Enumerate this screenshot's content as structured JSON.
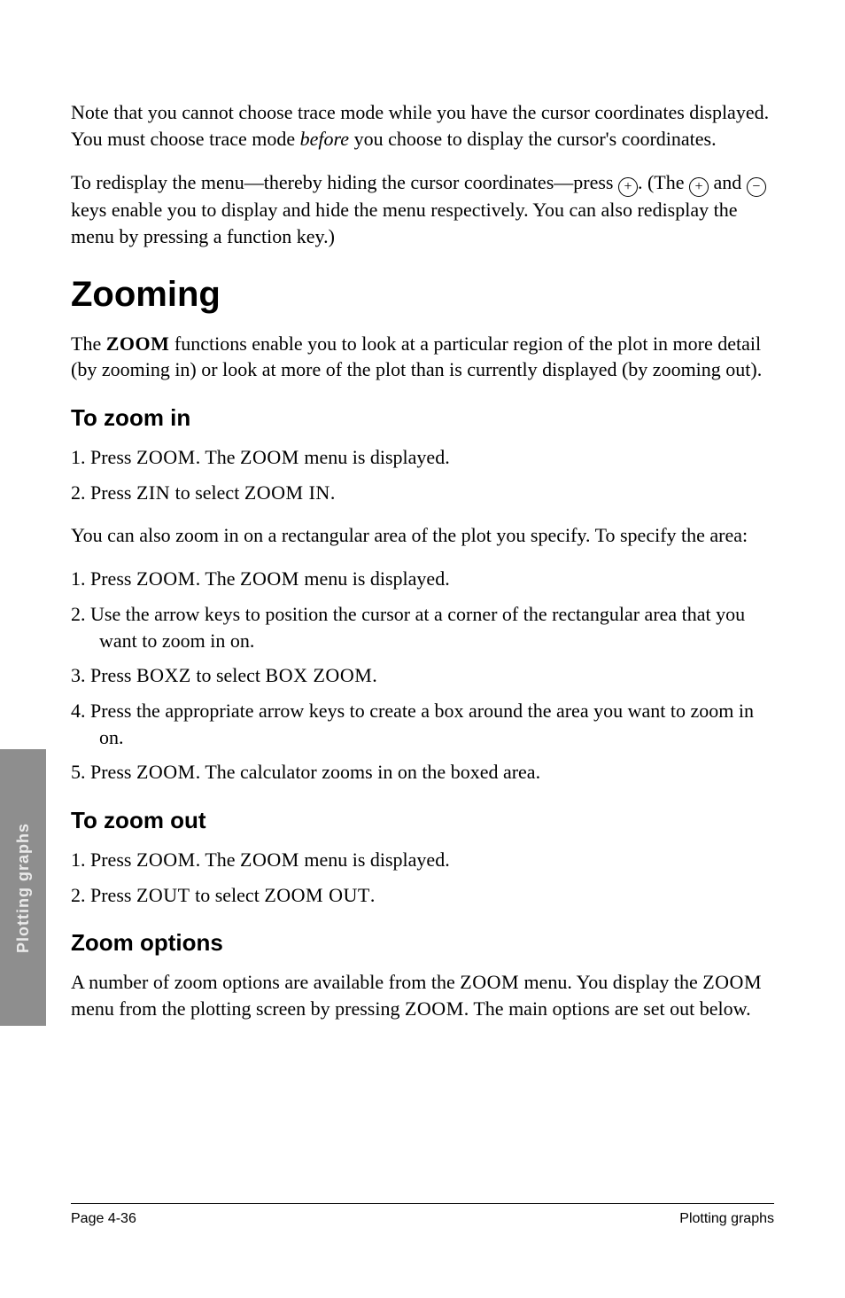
{
  "sidetab": {
    "label": "Plotting graphs"
  },
  "intro": {
    "p1a": "Note that you cannot choose trace mode while you have the cursor coordinates displayed. You must choose trace mode ",
    "p1b": "before",
    "p1c": " you choose to display the cursor's coordinates.",
    "p2a": "To redisplay the menu—thereby hiding the cursor coordinates—press ",
    "p2_key1": "+",
    "p2b": ". (The ",
    "p2_key2": "+",
    "p2c": " and ",
    "p2_key3": "−",
    "p2d": " keys enable you to display and hide the menu respectively. You can also redisplay the menu by pressing a function key.)"
  },
  "zooming": {
    "heading": "Zooming",
    "p_a": "The ",
    "p_key": "ZOOM",
    "p_b": " functions enable you to look at a particular region of the plot in more detail (by zooming in) or look at more of the plot than is currently displayed (by zooming out)."
  },
  "zoom_in": {
    "heading": "To zoom in",
    "list1": {
      "i1a": "Press ",
      "i1k": "ZOOM",
      "i1b": ". The ",
      "i1k2": "ZOOM",
      "i1c": " menu is displayed.",
      "i2a": "Press ",
      "i2k": "ZIN",
      "i2b": " to select ",
      "i2k2": "ZOOM IN",
      "i2c": "."
    },
    "p2": "You can also zoom in on a rectangular area of the plot you specify. To specify the area:",
    "list2": {
      "i1a": "Press ",
      "i1k": "ZOOM",
      "i1b": ". The ",
      "i1k2": "ZOOM",
      "i1c": " menu is displayed.",
      "i2": "Use the arrow keys to position the cursor at a corner of the rectangular area that you want to zoom in on.",
      "i3a": "Press ",
      "i3k": "BOXZ",
      "i3b": " to select ",
      "i3k2": "BOX ZOOM",
      "i3c": ".",
      "i4": "Press the appropriate arrow keys to create a box around the area you want to zoom in on.",
      "i5a": "Press ",
      "i5k": "ZOOM",
      "i5b": ". The calculator zooms in on the boxed area."
    }
  },
  "zoom_out": {
    "heading": "To zoom out",
    "list": {
      "i1a": "Press ",
      "i1k": "ZOOM",
      "i1b": ". The ",
      "i1k2": "ZOOM",
      "i1c": " menu is displayed.",
      "i2a": "Press ",
      "i2k": "ZOUT",
      "i2b": " to select ",
      "i2k2": "ZOOM OUT",
      "i2c": "."
    }
  },
  "zoom_options": {
    "heading": "Zoom options",
    "p_a": "A number of zoom options are available from the ",
    "p_k1": "ZOOM",
    "p_b": " menu. You display the ",
    "p_k2": "ZOOM",
    "p_c": " menu from the plotting screen by pressing ",
    "p_k3": "ZOOM",
    "p_d": ". The main options are set out below."
  },
  "footer": {
    "left": "Page 4-36",
    "right": "Plotting graphs"
  }
}
